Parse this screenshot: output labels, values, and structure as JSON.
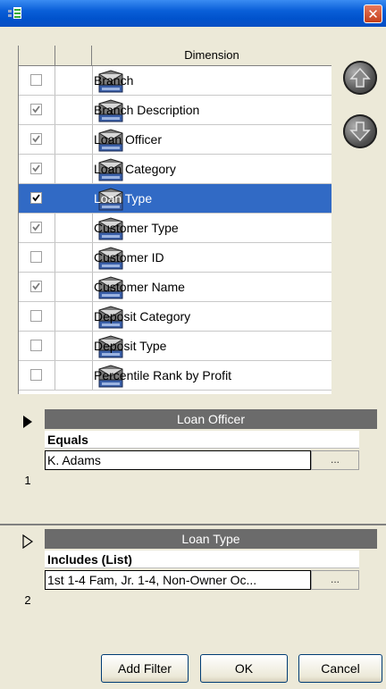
{
  "window": {
    "close_glyph": "✕"
  },
  "dimension_table": {
    "header": "Dimension",
    "rows": [
      {
        "label": "Branch",
        "checked": false,
        "selected": false
      },
      {
        "label": "Branch Description",
        "checked": true,
        "selected": false
      },
      {
        "label": "Loan Officer",
        "checked": true,
        "selected": false
      },
      {
        "label": "Loan Category",
        "checked": true,
        "selected": false
      },
      {
        "label": "Loan Type",
        "checked": true,
        "selected": true
      },
      {
        "label": "Customer Type",
        "checked": true,
        "selected": false
      },
      {
        "label": "Customer ID",
        "checked": false,
        "selected": false
      },
      {
        "label": "Customer Name",
        "checked": true,
        "selected": false
      },
      {
        "label": "Deposit Category",
        "checked": false,
        "selected": false
      },
      {
        "label": "Deposit Type",
        "checked": false,
        "selected": false
      },
      {
        "label": "Percentile Rank by Profit",
        "checked": false,
        "selected": false
      }
    ]
  },
  "move_buttons": {
    "up_icon": "arrow-up-icon",
    "down_icon": "arrow-down-icon"
  },
  "filters": [
    {
      "number": "1",
      "dimension": "Loan Officer",
      "operator": "Equals",
      "value": "K. Adams",
      "browse": "...",
      "active": true
    },
    {
      "number": "2",
      "dimension": "Loan Type",
      "operator": "Includes (List)",
      "value": "1st 1-4 Fam, Jr. 1-4, Non-Owner Oc...",
      "browse": "...",
      "active": false
    }
  ],
  "buttons": {
    "add_filter": "Add Filter",
    "ok": "OK",
    "cancel": "Cancel"
  },
  "colors": {
    "selection": "#316ac5",
    "filter_header": "#6b6b6b",
    "title_bar": "#0052cc"
  }
}
